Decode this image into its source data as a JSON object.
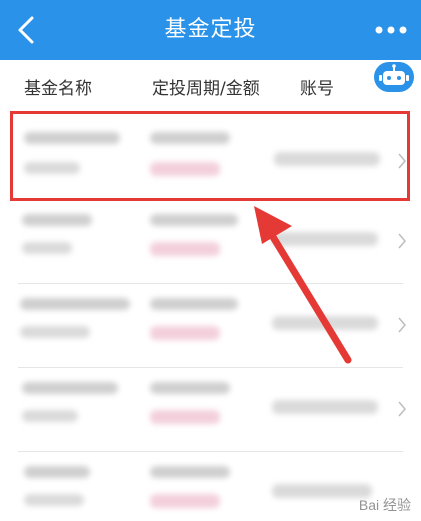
{
  "header": {
    "title": "基金定投",
    "back_icon": "chevron-left-icon",
    "more_icon": "ellipsis-icon",
    "bg_color": "#2a93e9"
  },
  "columns": {
    "name": "基金名称",
    "period_amount": "定投周期/金额",
    "account": "账号"
  },
  "assistant_icon": "robot-icon",
  "rows_count_visible": 5,
  "highlight_color": "#e53935",
  "watermark": "Bai 经验"
}
